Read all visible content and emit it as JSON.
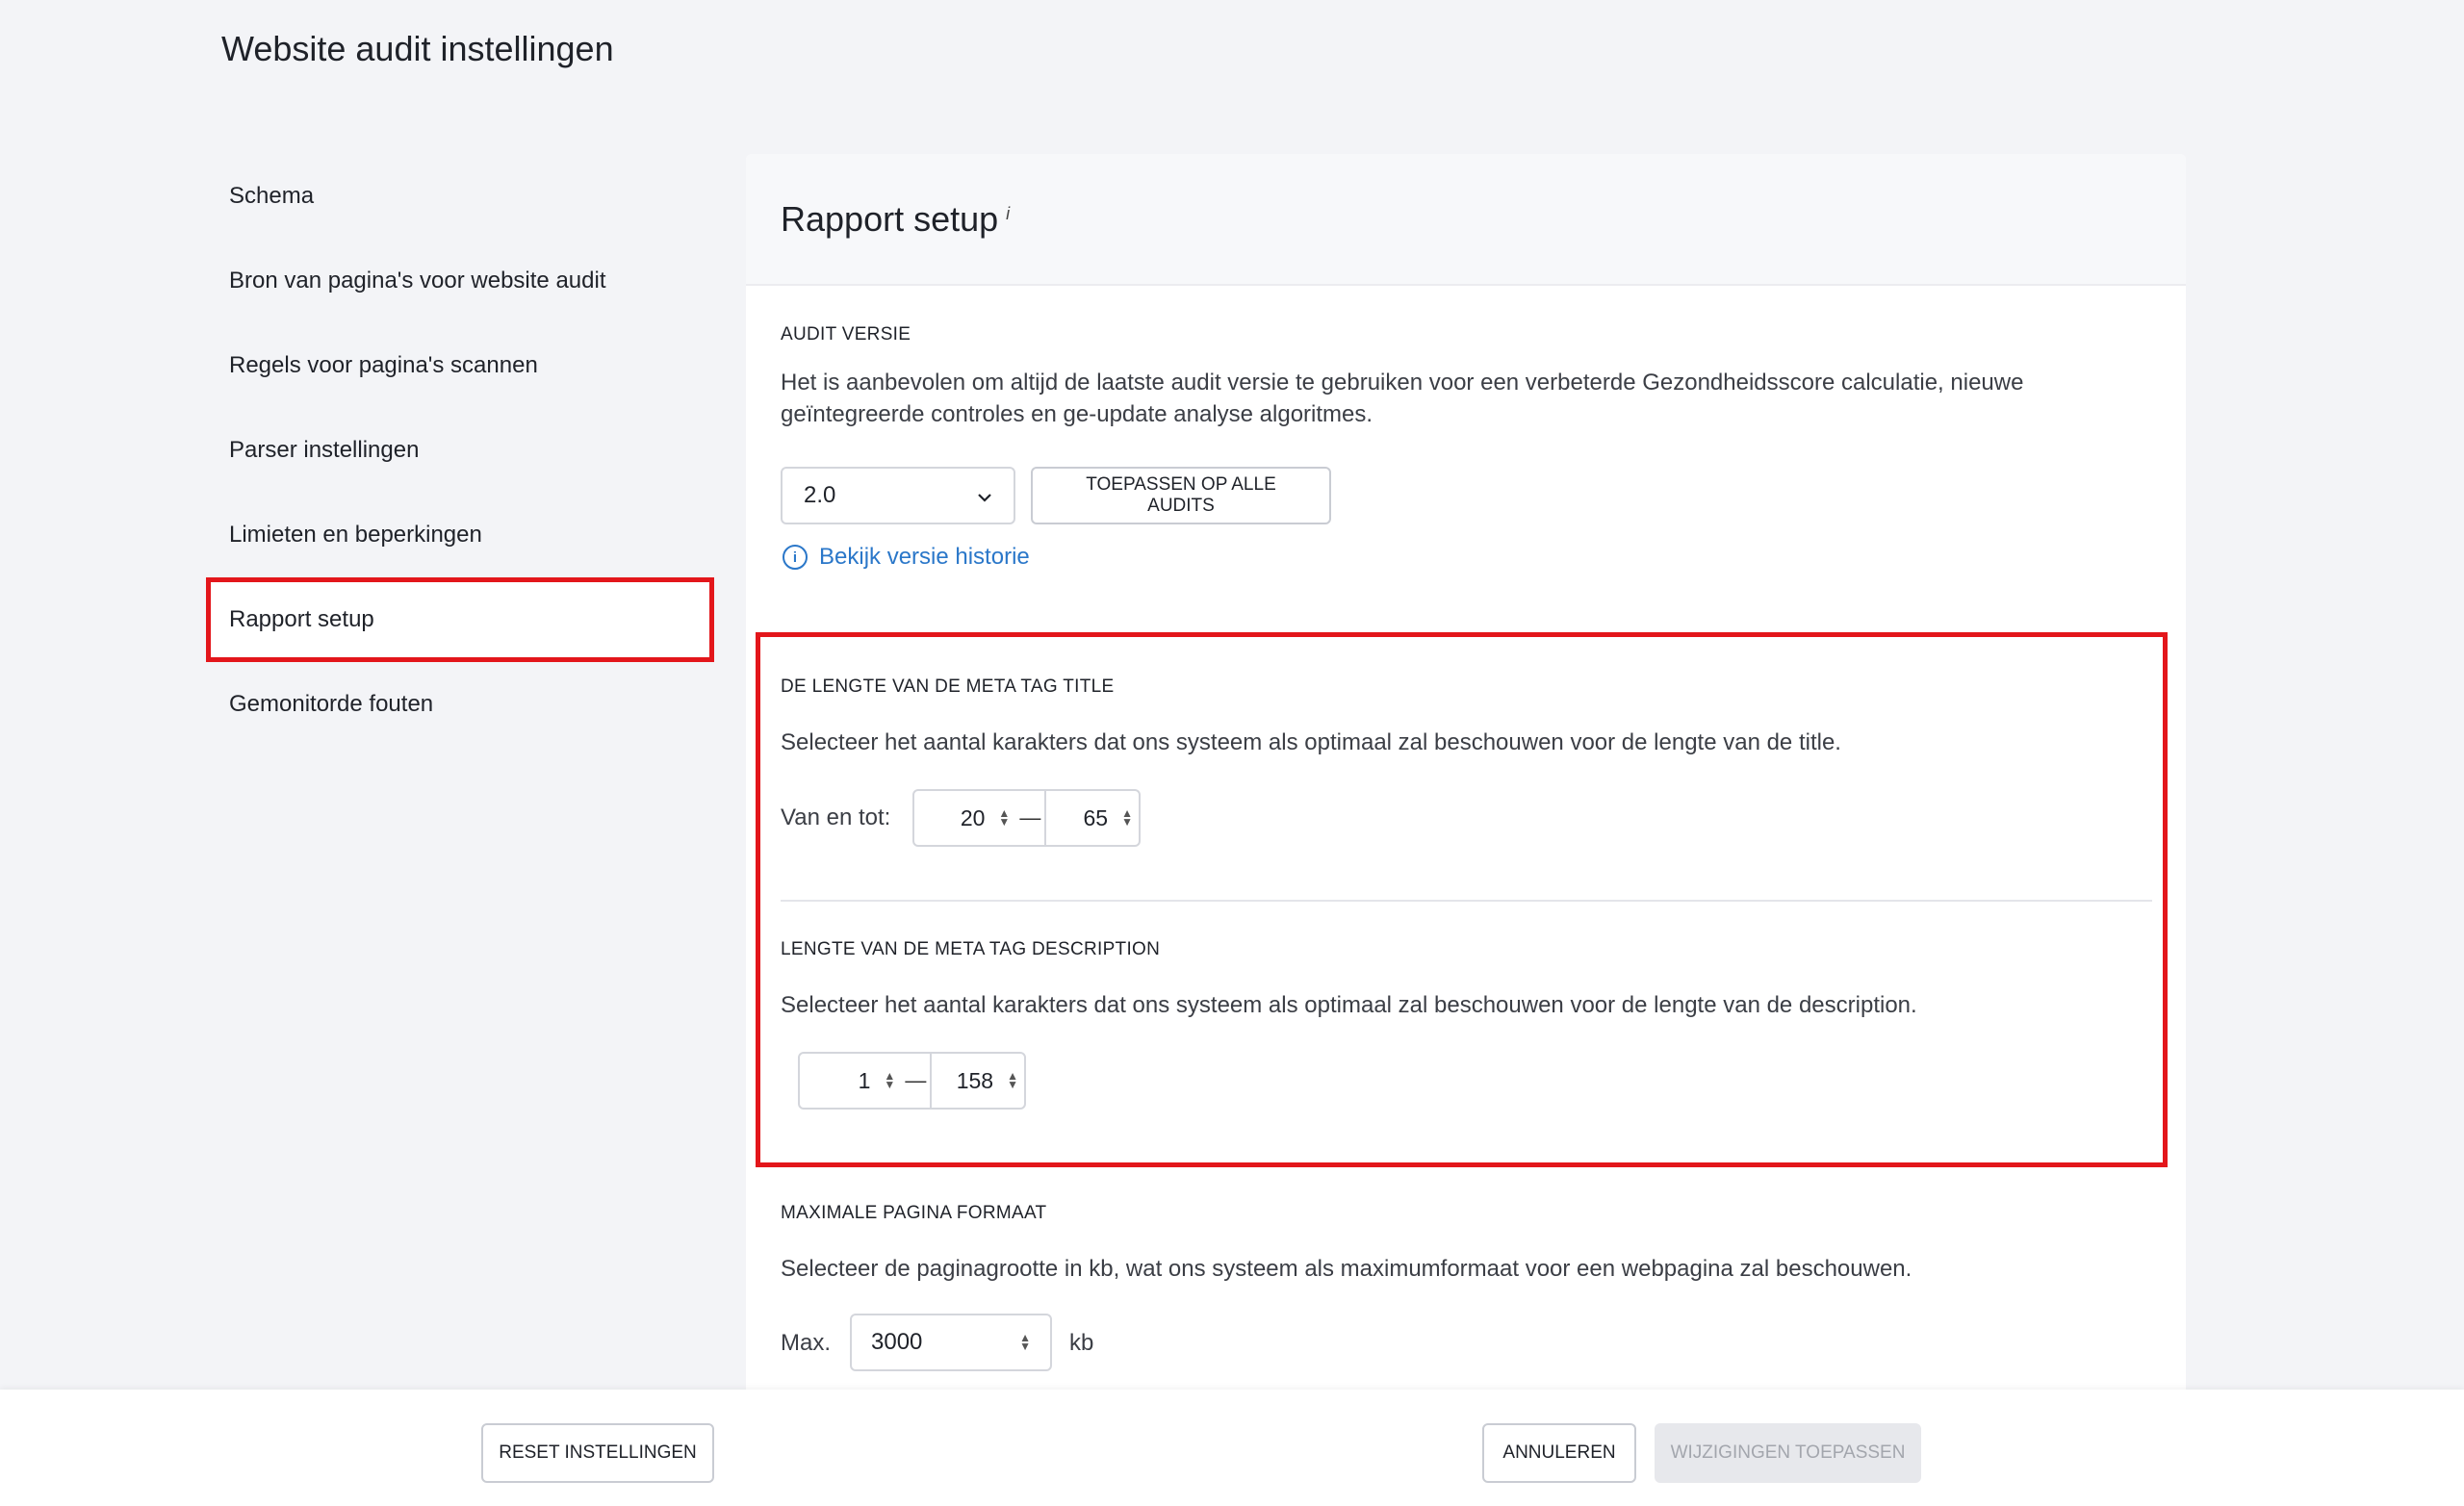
{
  "page": {
    "title": "Website audit instellingen"
  },
  "sidebar": {
    "items": [
      {
        "label": "Schema"
      },
      {
        "label": "Bron van pagina's voor website audit"
      },
      {
        "label": "Regels voor pagina's scannen"
      },
      {
        "label": "Parser instellingen"
      },
      {
        "label": "Limieten en beperkingen"
      },
      {
        "label": "Rapport setup",
        "active": true
      },
      {
        "label": "Gemonitorde fouten"
      }
    ]
  },
  "panel": {
    "title": "Rapport setup",
    "title_info": "i",
    "audit_version": {
      "label": "AUDIT VERSIE",
      "description": "Het is aanbevolen om altijd de laatste audit versie te gebruiken voor een verbeterde Gezondheidsscore calculatie, nieuwe geïntegreerde controles en ge-update analyse algoritmes.",
      "selected_version": "2.0",
      "apply_all_label": "TOEPASSEN OP ALLE AUDITS",
      "history_link": "Bekijk versie historie"
    },
    "title_length": {
      "label": "DE LENGTE VAN DE META TAG TITLE",
      "description": "Selecteer het aantal karakters dat ons systeem als optimaal zal beschouwen voor de lengte van de title.",
      "range_label": "Van en tot:",
      "from": "20",
      "to": "65"
    },
    "description_length": {
      "label": "LENGTE VAN DE META TAG DESCRIPTION",
      "description": "Selecteer het aantal karakters dat ons systeem als optimaal zal beschouwen voor de lengte van de description.",
      "from": "1",
      "to": "158"
    },
    "max_page_size": {
      "label": "MAXIMALE PAGINA FORMAAT",
      "description": "Selecteer de paginagrootte in kb, wat ons systeem als maximumformaat voor een webpagina zal beschouwen.",
      "prefix": "Max.",
      "value": "3000",
      "unit": "kb"
    }
  },
  "footer": {
    "reset_label": "RESET INSTELLINGEN",
    "cancel_label": "ANNULEREN",
    "apply_label": "WIJZIGINGEN TOEPASSEN"
  },
  "colors": {
    "highlight": "#e3161b",
    "link": "#2a77c9"
  }
}
